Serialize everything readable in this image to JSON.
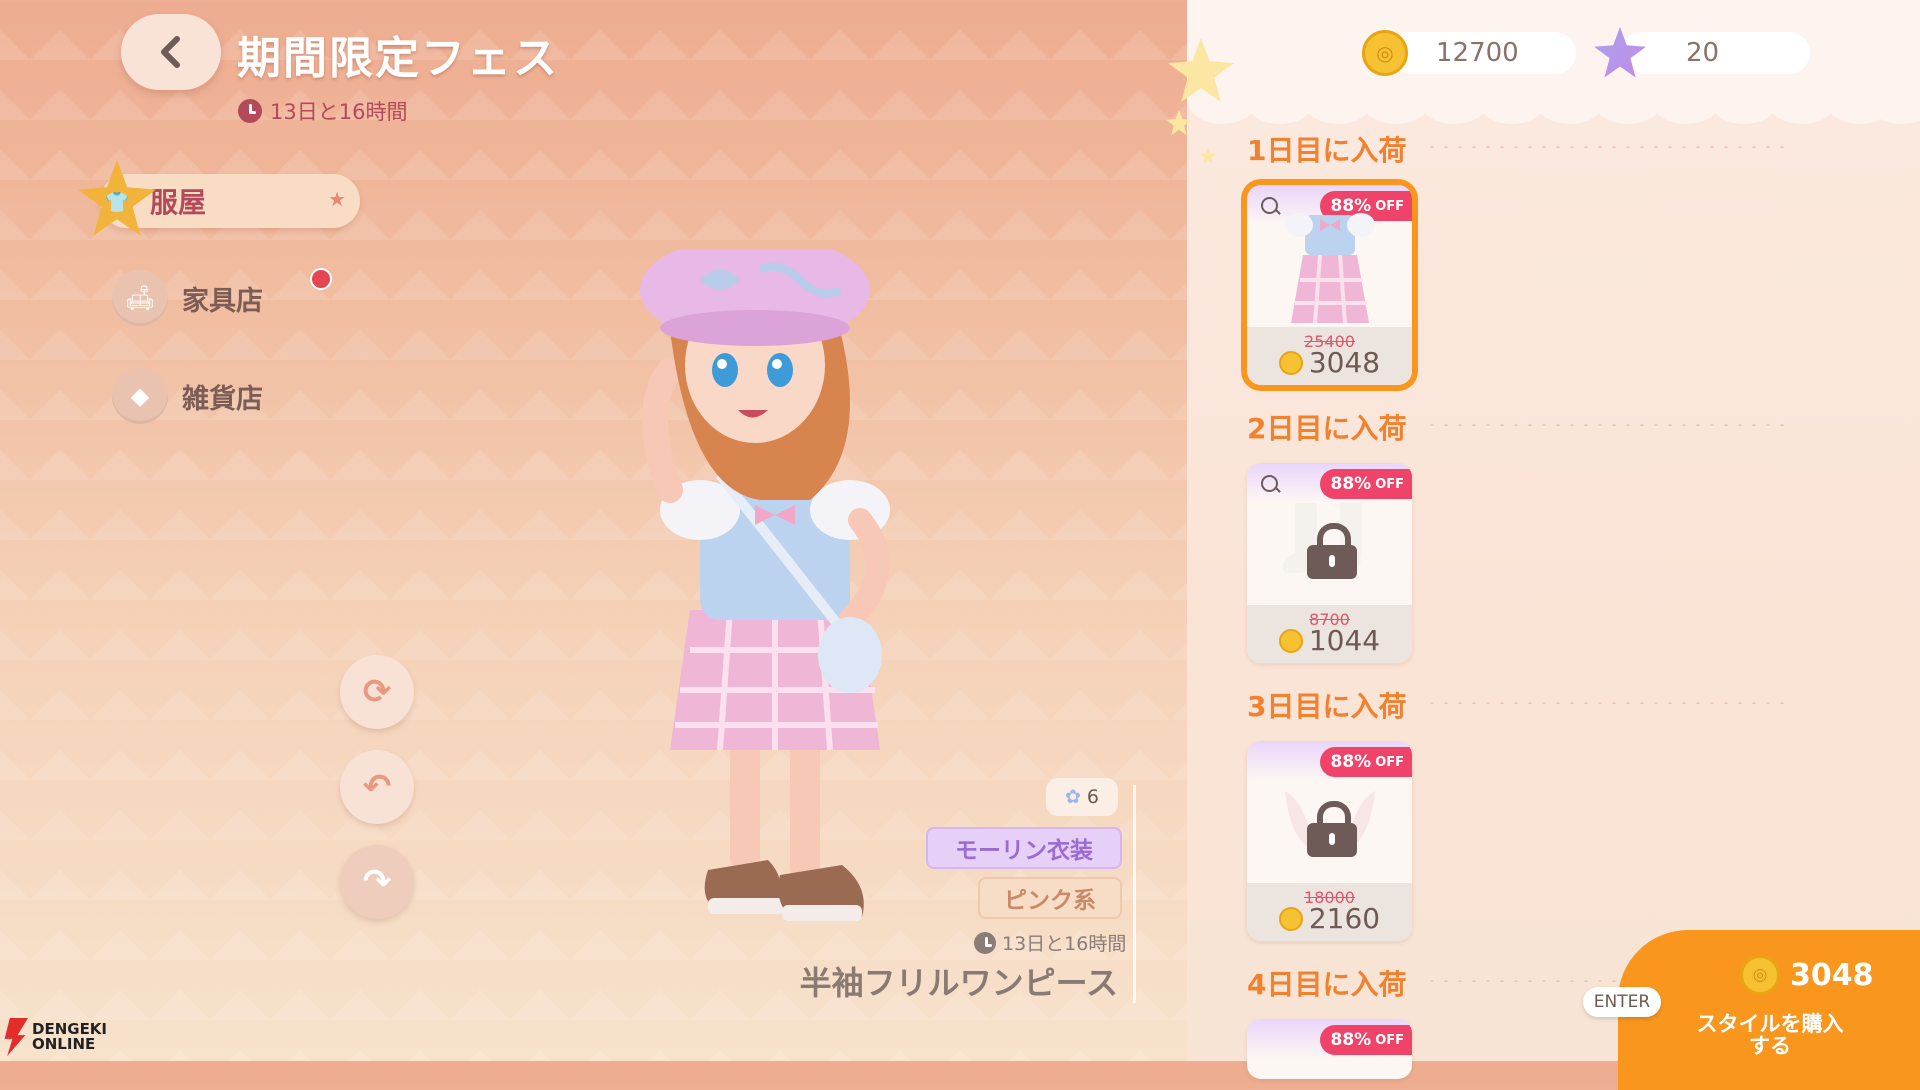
{
  "header": {
    "title": "期間限定フェス",
    "timer": "13日と16時間"
  },
  "nav": {
    "items": [
      {
        "label": "服屋",
        "active": true
      },
      {
        "label": "家具店",
        "active": false,
        "notification": true
      },
      {
        "label": "雑貨店",
        "active": false
      }
    ]
  },
  "currency": {
    "coins": "12700",
    "stars": "20"
  },
  "item": {
    "count": "6",
    "tag1": "モーリン衣装",
    "tag2": "ピンク系",
    "timer": "13日と16時間",
    "name": "半袖フリルワンピース"
  },
  "days": [
    {
      "label": "1日目に入荷",
      "discount": "88%",
      "discount_suffix": "OFF",
      "old_price": "25400",
      "price": "3048",
      "locked": false,
      "selected": true
    },
    {
      "label": "2日目に入荷",
      "discount": "88%",
      "discount_suffix": "OFF",
      "old_price": "8700",
      "price": "1044",
      "locked": true,
      "selected": false
    },
    {
      "label": "3日目に入荷",
      "discount": "88%",
      "discount_suffix": "OFF",
      "old_price": "18000",
      "price": "2160",
      "locked": true,
      "selected": false
    },
    {
      "label": "4日目に入荷",
      "discount": "88%",
      "discount_suffix": "OFF"
    }
  ],
  "buy": {
    "price": "3048",
    "label": "スタイルを購入する",
    "key": "ENTER"
  },
  "watermark": {
    "line1": "DENGEKI",
    "line2": "ONLINE"
  },
  "icons": {
    "back": "chevron-left-icon",
    "clock": "clock-icon",
    "coin": "coin-icon",
    "star": "star-icon",
    "lock": "lock-icon",
    "search": "search-icon"
  },
  "colors": {
    "accent": "#f8961e",
    "title_red": "#b24a5a",
    "discount_badge": "#f0436a",
    "day_label": "#f0812f"
  }
}
